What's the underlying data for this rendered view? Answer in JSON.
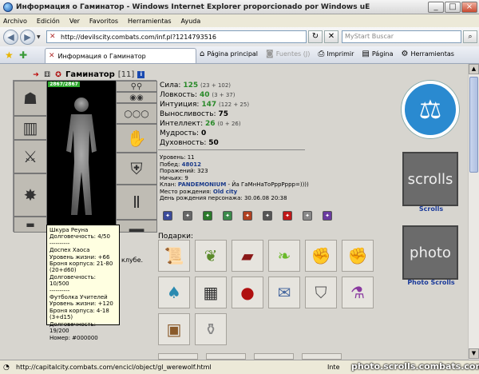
{
  "window": {
    "title": "Информация о Гаминатор - Windows Internet Explorer proporcionado por Windows uE",
    "minimize": "_",
    "maximize": "□",
    "close": "×"
  },
  "menu": [
    "Archivo",
    "Edición",
    "Ver",
    "Favoritos",
    "Herramientas",
    "Ayuda"
  ],
  "address": {
    "url": "http://devilscity.combats.com/inf.pl?1214793516",
    "search_placeholder": "MyStart Buscar"
  },
  "tab": {
    "label": "Информация о Гаминатор"
  },
  "commands": {
    "home": "Página principal",
    "feeds": "Fuentes (J)",
    "print": "Imprimir",
    "page": "Página",
    "tools": "Herramientas"
  },
  "character": {
    "name": "Гаминатор",
    "level": "[11]",
    "info_icon": "i",
    "hp": "2867/2867"
  },
  "stats": [
    {
      "label": "Сила:",
      "value": "125",
      "sub": "(23 + 102)",
      "color": "green"
    },
    {
      "label": "Ловкость:",
      "value": "40",
      "sub": "(3 + 37)",
      "color": "green"
    },
    {
      "label": "Интуиция:",
      "value": "147",
      "sub": "(122 + 25)",
      "color": "green"
    },
    {
      "label": "Выносливость:",
      "value": "75",
      "sub": "",
      "color": "black"
    },
    {
      "label": "Интеллект:",
      "value": "26",
      "sub": "(0 + 26)",
      "color": "green"
    },
    {
      "label": "Мудрость:",
      "value": "0",
      "sub": "",
      "color": "black"
    },
    {
      "label": "Духовность:",
      "value": "50",
      "sub": "",
      "color": "black"
    }
  ],
  "info": {
    "level_label": "Уровень:",
    "level_value": "11",
    "wins_label": "Побед:",
    "wins_value": "48012",
    "losses_label": "Поражений:",
    "losses_value": "323",
    "draws_label": "Ничьих:",
    "draws_value": "9",
    "clan_label": "Клан:",
    "clan_value": "PANDEMONIUM",
    "clan_motto": "- Йа ГаМнНаТоРррРррр=))))",
    "birthplace_label": "Место рождения:",
    "birthplace_value": "Old city",
    "birthday_label": "День рождения персонажа:",
    "birthday_value": "30.06.08 20:38"
  },
  "gifts_label": "Подарки:",
  "side_note": "клубе.",
  "right_column": {
    "scrolls_label": "Scrolls",
    "photo_scrolls_label": "Photo Scrolls",
    "banner1_text": "scrolls",
    "banner2_text": "photo"
  },
  "tooltip": [
    "Шкура Реуна",
    "Долговечность: 4/50",
    "----------",
    "Доспех Хаоса",
    "Уровень жизни: +66",
    "Броня корпуса: 21-80 (20+d60)",
    "Долговечность: 10/500",
    "----------",
    "Футболка Учителей",
    "Уровень жизни: +120",
    "Броня корпуса: 4-18 (3+d15)",
    "Долговечность: 19/200",
    "Номер: #000000"
  ],
  "status": {
    "url": "http://capitalcity.combats.com/encicl/object/gl_werewolf.html",
    "zone": "Inte",
    "watermark": "photo.scrolls.combats.com"
  },
  "colors": {
    "stat_green": "#2a8a2a",
    "clan_blue": "#1a3a8a",
    "tooltip_bg": "#ffffe1",
    "law_blue": "#2a8ad0"
  }
}
